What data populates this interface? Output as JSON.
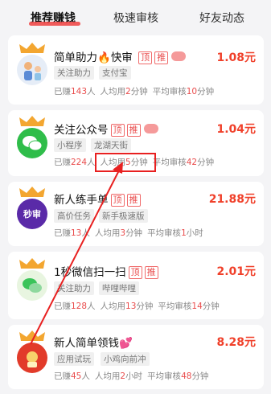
{
  "tabs": [
    {
      "label": "推荐赚钱"
    },
    {
      "label": "极速审核"
    },
    {
      "label": "好友动态"
    }
  ],
  "tasks": [
    {
      "title": "简单助力",
      "title_extra": "快审",
      "badges": [
        "顶",
        "推"
      ],
      "price": "1.08元",
      "tags": [
        "关注助力",
        "支付宝"
      ],
      "earned_label_a": "已赚",
      "earned": "143",
      "earned_label_b": "人",
      "avg_label_a": "人均用",
      "avg": "2",
      "avg_label_b": "分钟",
      "review_label_a": "平均审核",
      "review": "10",
      "review_label_b": "分钟"
    },
    {
      "title": "关注公众号",
      "badges": [
        "顶",
        "推"
      ],
      "price": "1.04元",
      "tags": [
        "小程序",
        "龙湖天街"
      ],
      "earned_label_a": "已赚",
      "earned": "224",
      "earned_label_b": "人",
      "avg_label_a": "人均用",
      "avg": "5",
      "avg_label_b": "分钟",
      "review_label_a": "平均审核",
      "review": "42",
      "review_label_b": "分钟"
    },
    {
      "title": "新人练手单",
      "icon_text": "秒审",
      "badges": [
        "顶",
        "推"
      ],
      "price": "21.88元",
      "tags": [
        "高价任务",
        "新手极速版"
      ],
      "earned_label_a": "已赚",
      "earned": "13",
      "earned_label_b": "人",
      "avg_label_a": "人均用",
      "avg": "3",
      "avg_label_b": "分钟",
      "review_label_a": "平均审核",
      "review": "1",
      "review_label_b": "小时"
    },
    {
      "title": "1秒微信扫一扫",
      "badges": [
        "顶",
        "推"
      ],
      "price": "2.01元",
      "tags": [
        "关注助力",
        "哔哩哔哩"
      ],
      "earned_label_a": "已赚",
      "earned": "128",
      "earned_label_b": "人",
      "avg_label_a": "人均用",
      "avg": "13",
      "avg_label_b": "分钟",
      "review_label_a": "平均审核",
      "review": "14",
      "review_label_b": "分钟"
    },
    {
      "title": "新人简单领钱",
      "badges": [
        "顶",
        "推"
      ],
      "price": "8.28元",
      "tags": [
        "应用试玩",
        "小鸡向前冲"
      ],
      "earned_label_a": "已赚",
      "earned": "45",
      "earned_label_b": "人",
      "avg_label_a": "人均用",
      "avg": "2",
      "avg_label_b": "小时",
      "review_label_a": "平均审核",
      "review": "48",
      "review_label_b": "分钟"
    }
  ],
  "colors": {
    "accent": "#ef4040",
    "price": "#f0402a",
    "annotation": "#e82020"
  }
}
